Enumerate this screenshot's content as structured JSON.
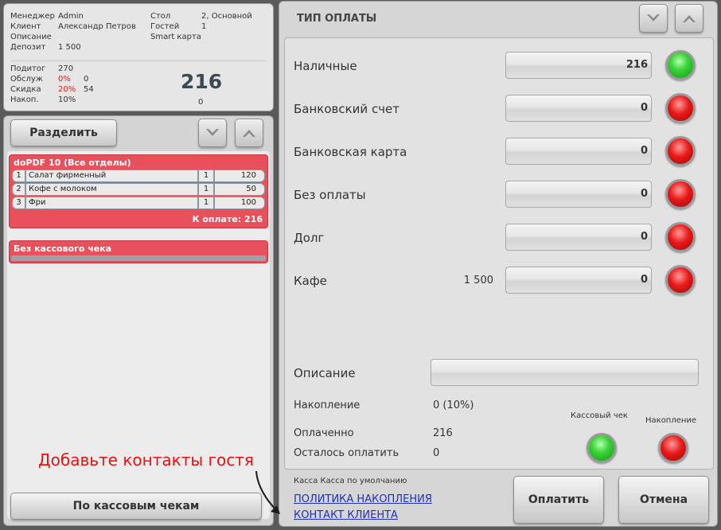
{
  "info": {
    "rows_left": [
      {
        "k": "Менеджер",
        "v": "Admin"
      },
      {
        "k": "Клиент",
        "v": "Александр Петров"
      },
      {
        "k": "Описание",
        "v": ""
      },
      {
        "k": "Депозит",
        "v": "1 500"
      }
    ],
    "rows_right": [
      {
        "k": "Стол",
        "v": "2, Основной"
      },
      {
        "k": "Гостей",
        "v": "1"
      },
      {
        "k": "Smart карта",
        "v": ""
      }
    ],
    "totals": [
      {
        "k": "Подитог",
        "pct": "",
        "v": "270"
      },
      {
        "k": "Обслуж",
        "pct": "0%",
        "v": "0"
      },
      {
        "k": "Скидка",
        "pct": "20%",
        "v": "54"
      },
      {
        "k": "Накоп.",
        "pct": "10%",
        "v": ""
      }
    ],
    "total_big": "216",
    "nakop_value": "0"
  },
  "order": {
    "split_label": "Разделить",
    "groups": [
      {
        "title": "doPDF 10 (Все отделы)",
        "items": [
          {
            "n": "1",
            "name": "Салат фирменный",
            "qty": "1",
            "price": "120"
          },
          {
            "n": "2",
            "name": "Кофе с молоком",
            "qty": "1",
            "price": "50"
          },
          {
            "n": "3",
            "name": "Фри",
            "qty": "1",
            "price": "100"
          }
        ],
        "total": "К оплате: 216"
      },
      {
        "title": "Без кассового чека"
      }
    ],
    "by_receipts_label": "По кассовым чекам"
  },
  "payment": {
    "title": "ТИП ОПЛАТЫ",
    "methods": [
      {
        "label": "Наличные",
        "deposit": "",
        "value": "216",
        "status": "green"
      },
      {
        "label": "Банковский счет",
        "deposit": "",
        "value": "0",
        "status": "red"
      },
      {
        "label": "Банковская карта",
        "deposit": "",
        "value": "0",
        "status": "red"
      },
      {
        "label": "Без оплаты",
        "deposit": "",
        "value": "0",
        "status": "red"
      },
      {
        "label": "Долг",
        "deposit": "",
        "value": "0",
        "status": "red"
      },
      {
        "label": "Кафе",
        "deposit": "1 500",
        "value": "0",
        "status": "red"
      }
    ],
    "description_label": "Описание",
    "accumulation_label": "Накопление",
    "accumulation_value": "0 (10%)",
    "paid_label": "Оплаченно",
    "paid_value": "216",
    "remaining_label": "Осталось оплатить",
    "remaining_value": "0",
    "receipt_toggle_label": "Кассовый чек",
    "accumulation_toggle_label": "Накопление",
    "kassa_text": "Касса  Касса по умолчанию",
    "link_policy": "ПОЛИТИКА НАКОПЛЕНИЯ",
    "link_contact": "КОНТАКТ КЛИЕНТА",
    "pay_label": "Оплатить",
    "cancel_label": "Отмена"
  },
  "annotation": "Добавьте контакты гостя",
  "colors": {
    "group_red": "#e8505c",
    "link_blue": "#2030b0",
    "annotation_red": "#e81010"
  }
}
